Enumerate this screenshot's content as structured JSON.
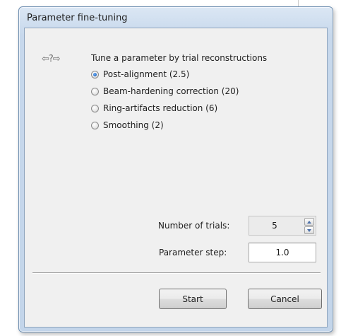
{
  "window": {
    "title": "Parameter fine-tuning"
  },
  "help": {
    "icon": "help-arrows-icon",
    "glyph": "⇦?⇨"
  },
  "tune_group": {
    "title": "Tune a parameter by trial reconstructions",
    "selected_index": 0,
    "options": [
      {
        "label": "Post-alignment (2.5)"
      },
      {
        "label": "Beam-hardening correction (20)"
      },
      {
        "label": "Ring-artifacts reduction (6)"
      },
      {
        "label": "Smoothing (2)"
      }
    ]
  },
  "trials": {
    "label": "Number of trials:",
    "value": "5"
  },
  "step": {
    "label": "Parameter step:",
    "value": "1.0"
  },
  "buttons": {
    "start_label": "Start",
    "cancel_label": "Cancel"
  },
  "colors": {
    "window_frame": "#c3d5ea",
    "client_bg": "#f0f0f0",
    "radio_selected": "#1d5fb3"
  }
}
